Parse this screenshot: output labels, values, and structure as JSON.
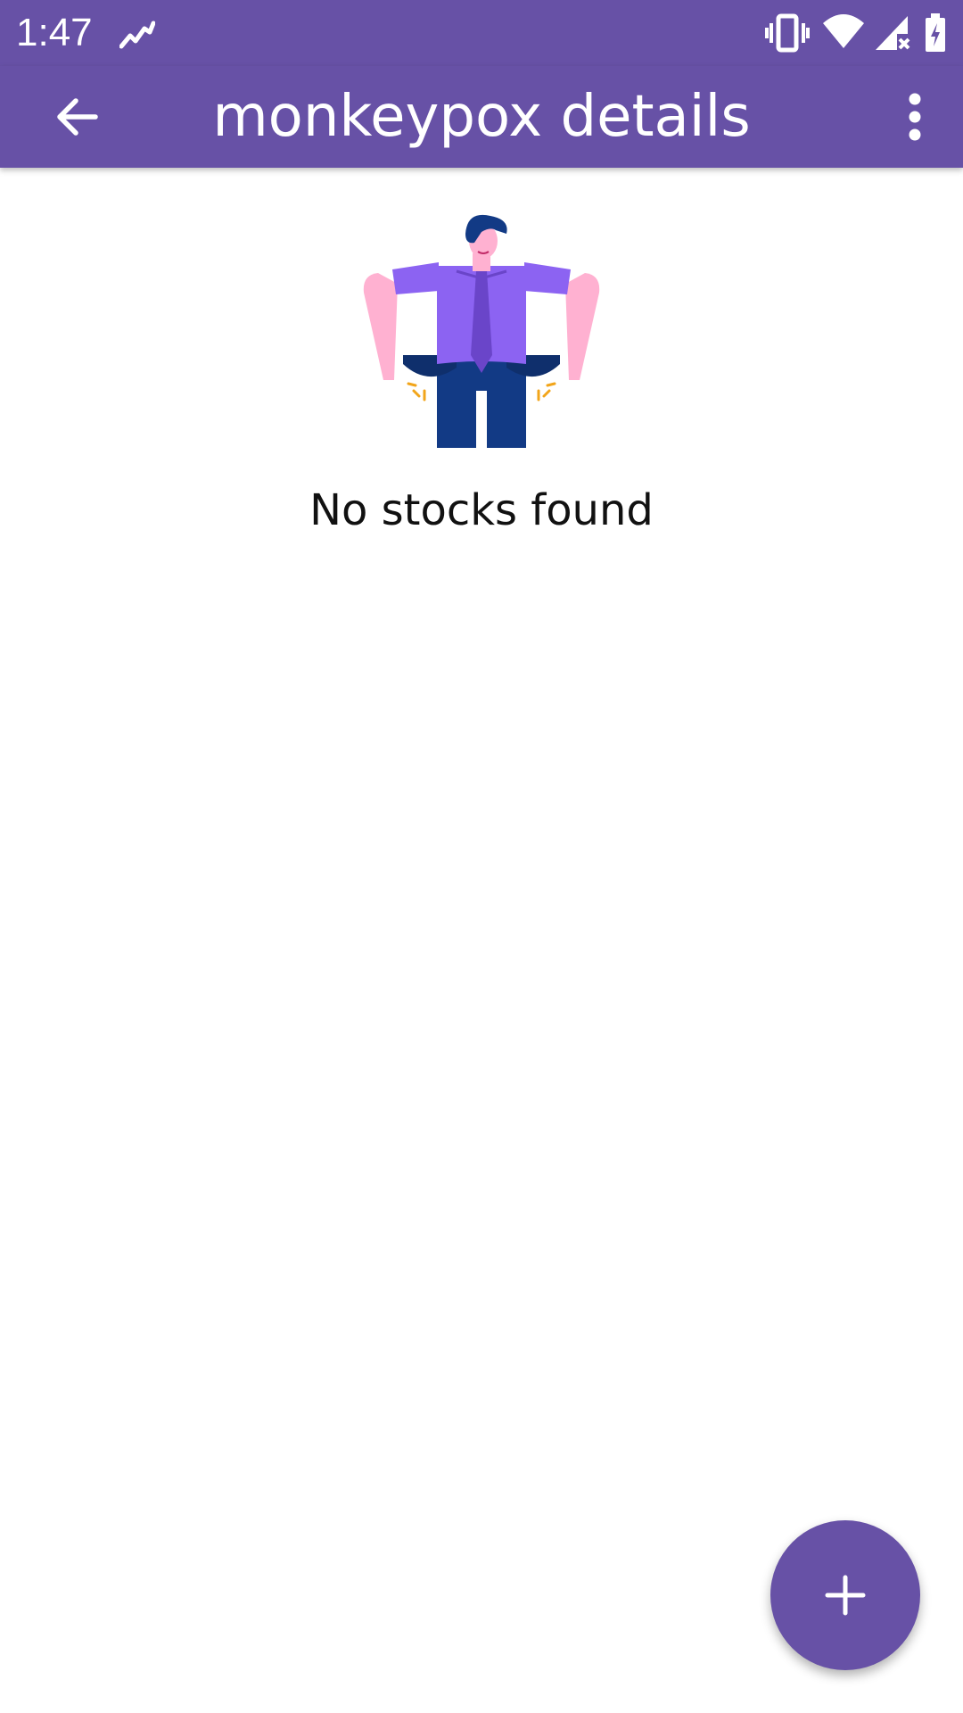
{
  "status_bar": {
    "time": "1:47",
    "icons": [
      "stock-chart-icon",
      "vibrate-icon",
      "wifi-icon",
      "signal-icon",
      "battery-charging-icon"
    ]
  },
  "app_bar": {
    "title": "monkeypox details",
    "back_icon": "arrow-back-icon",
    "overflow_icon": "more-vert-icon"
  },
  "empty_state": {
    "illustration": "empty-pockets-man",
    "message": "No stocks found"
  },
  "fab": {
    "icon": "add-icon"
  },
  "colors": {
    "primary": "#6751a6",
    "background": "#ffffff",
    "text": "#111111"
  }
}
